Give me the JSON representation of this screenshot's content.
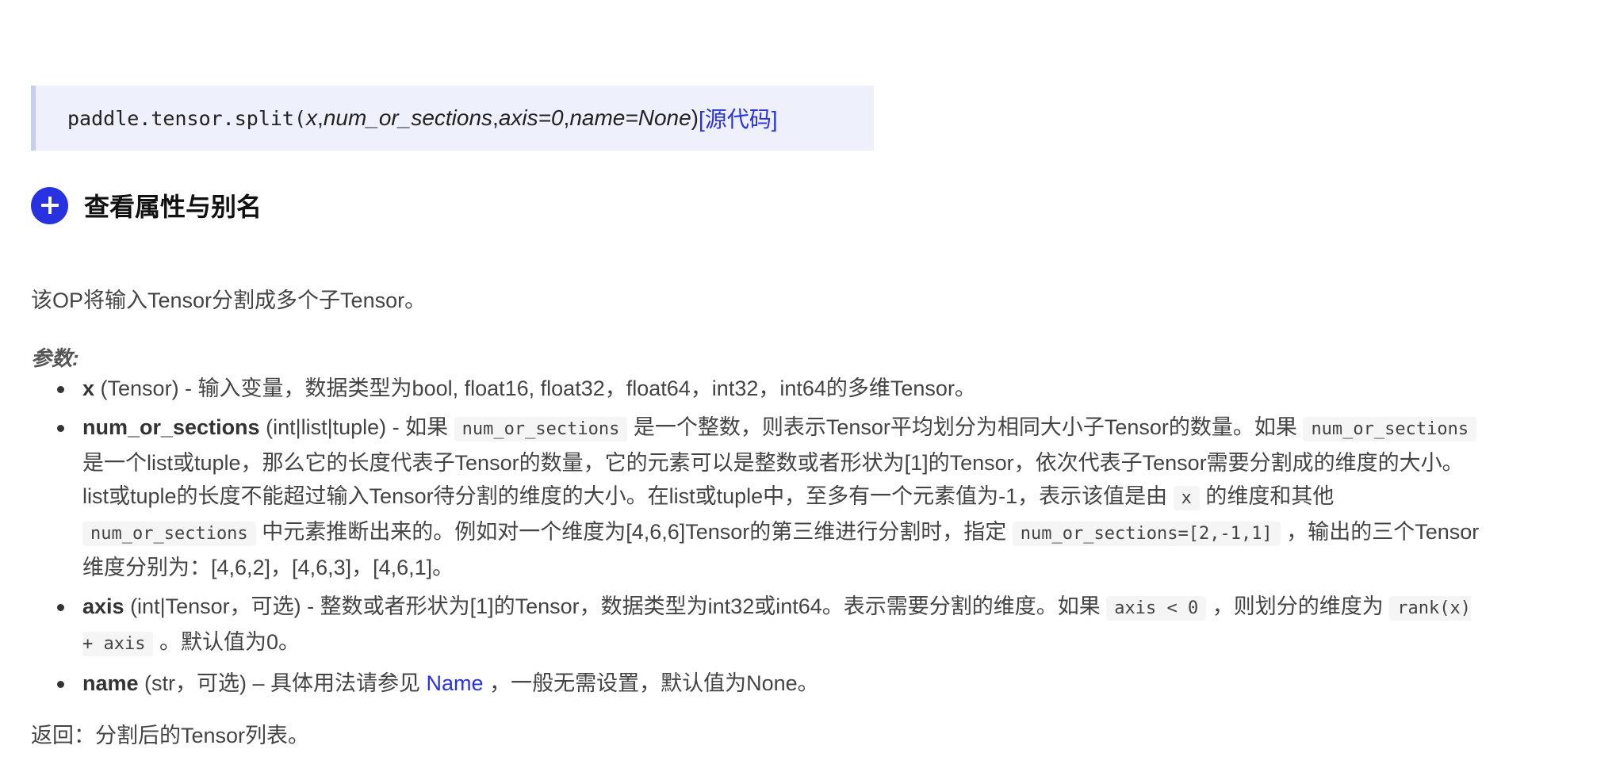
{
  "signature": {
    "func": "paddle.tensor.split(",
    "arg_x": "x",
    "sep1": ", ",
    "arg_num": "num_or_sections",
    "sep2": ", ",
    "arg_axis": "axis=0",
    "sep3": ", ",
    "arg_name": "name=None",
    "close": ")",
    "source_link": "[源代码]"
  },
  "alias_section": {
    "title": "查看属性与别名",
    "icon": "plus-icon"
  },
  "description": "该OP将输入Tensor分割成多个子Tensor。",
  "params_label": "参数:",
  "params": {
    "x": {
      "name": "x",
      "text": " (Tensor) - 输入变量，数据类型为bool, float16, float32，float64，int32，int64的多维Tensor。"
    },
    "num_or_sections": {
      "name": "num_or_sections",
      "t1": " (int|list|tuple) - 如果 ",
      "c1": "num_or_sections",
      "t2": " 是一个整数，则表示Tensor平均划分为相同大小子Tensor的数量。如果 ",
      "c2": "num_or_sections",
      "t3": " 是一个list或tuple，那么它的长度代表子Tensor的数量，它的元素可以是整数或者形状为[1]的Tensor，依次代表子Tensor需要分割成的维度的大小。list或tuple的长度不能超过输入Tensor待分割的维度的大小。在list或tuple中，至多有一个元素值为-1，表示该值是由 ",
      "c3": "x",
      "t4": " 的维度和其他 ",
      "c4": "num_or_sections",
      "t5": " 中元素推断出来的。例如对一个维度为[4,6,6]Tensor的第三维进行分割时，指定 ",
      "c5": "num_or_sections=[2,-1,1]",
      "t6": " ，输出的三个Tensor维度分别为：[4,6,2]，[4,6,3]，[4,6,1]。"
    },
    "axis": {
      "name": "axis",
      "t1": " (int|Tensor，可选) - 整数或者形状为[1]的Tensor，数据类型为int32或int64。表示需要分割的维度。如果 ",
      "c1": "axis < 0",
      "t2": " ，则划分的维度为 ",
      "c2": "rank(x) + axis",
      "t3": " 。默认值为0。"
    },
    "name": {
      "name": "name",
      "t1": " (str，可选) – 具体用法请参见 ",
      "link": "Name",
      "t2": " ，一般无需设置，默认值为None。"
    }
  },
  "returns": "返回：分割后的Tensor列表。",
  "colors": {
    "accent": "#2932e1",
    "signature_bg": "#eef0fb",
    "code_bg": "#f5f5f5"
  }
}
